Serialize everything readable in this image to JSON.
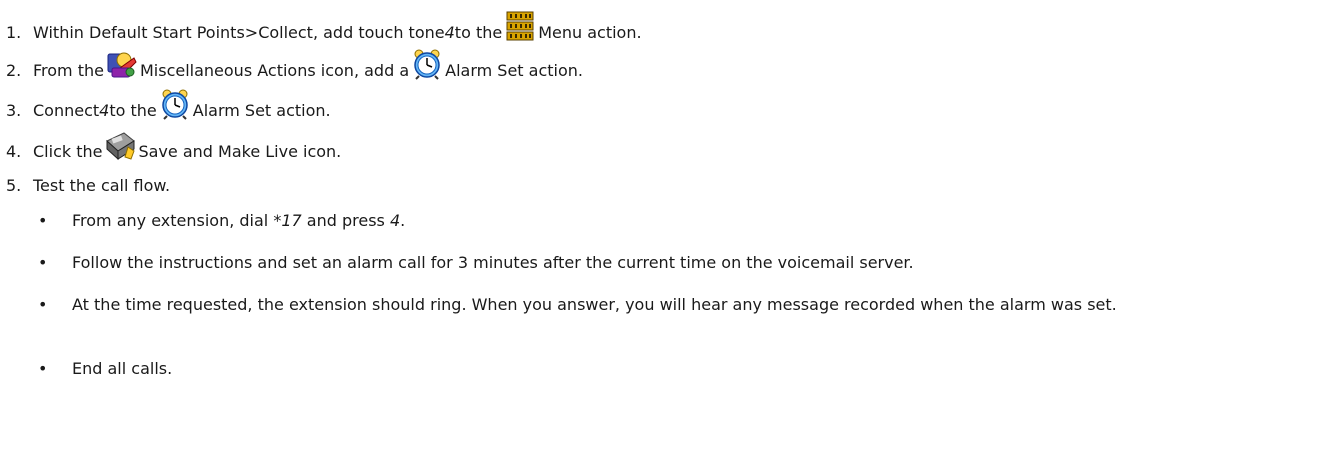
{
  "steps": [
    {
      "num": "1.",
      "a": "Within Default Start Points>Collect, add touch tone ",
      "b": "4",
      "c": " to the ",
      "d": " Menu action."
    },
    {
      "num": "2.",
      "a": "From the ",
      "b": " Miscellaneous Actions icon, add a ",
      "c": " Alarm Set action."
    },
    {
      "num": "3.",
      "a": "Connect ",
      "b": "4",
      "c": " to the ",
      "d": " Alarm Set action."
    },
    {
      "num": "4.",
      "a": "Click the ",
      "b": " Save and Make Live icon."
    },
    {
      "num": "5.",
      "a": "Test the call flow."
    }
  ],
  "bullets": {
    "b1": {
      "a": "From any extension, dial ",
      "b": "*17",
      "c": " and press ",
      "d": "4",
      "e": "."
    },
    "b2": "Follow the instructions and set an alarm call for 3 minutes after the current time on the voicemail server.",
    "b3": "At the time requested, the extension should ring. When you answer, you will hear any message recorded when the alarm was set.",
    "b4": "End all calls."
  },
  "icons": {
    "menu": "menu-grid-icon",
    "misc": "miscellaneous-actions-icon",
    "alarm": "alarm-clock-icon",
    "save": "save-make-live-icon"
  },
  "bullet_char": "•"
}
